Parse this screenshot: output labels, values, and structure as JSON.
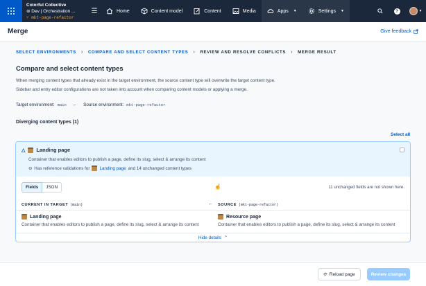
{
  "nav": {
    "org": "Colorful Collective",
    "environment": "Dev | Orchestration ...",
    "branch": "mkt-page-refactor",
    "items": [
      {
        "label": "Home"
      },
      {
        "label": "Content model"
      },
      {
        "label": "Content"
      },
      {
        "label": "Media"
      },
      {
        "label": "Apps"
      },
      {
        "label": "Settings"
      }
    ]
  },
  "header": {
    "title": "Merge",
    "feedback": "Give feedback"
  },
  "steps": [
    {
      "label": "SELECT ENVIRONMENTS"
    },
    {
      "label": "COMPARE AND SELECT CONTENT TYPES"
    },
    {
      "label": "REVIEW AND RESOLVE CONFLICTS"
    },
    {
      "label": "MERGE RESULT"
    }
  ],
  "main": {
    "heading": "Compare and select content types",
    "desc1": "When merging content types that already exist in the target environment, the source content type will overwrite the target content type.",
    "desc2": "Sidebar and entry editor configurations are not taken into account when comparing content models or applying a merge.",
    "target_label": "Target environment:",
    "target_value": "main",
    "source_label": "Source environment:",
    "source_value": "mkt-page-refactor",
    "diverging": "Diverging content types (1)",
    "select_all": "Select all"
  },
  "card": {
    "name": "Landing page",
    "description": "Container that enables editors to publish a page, define its slug, select & arrange its content",
    "ref_prefix": "Has reference validations for",
    "ref_link": "Landing page",
    "ref_suffix": "and 14 unchanged content types",
    "tab_fields": "Fields",
    "tab_json": "JSON",
    "unchanged_note": "11 unchanged fields are not shown here.",
    "target_col": "CURRENT IN TARGET",
    "target_env": "(main)",
    "source_col": "SOURCE",
    "source_env": "(mkt-page-refactor)",
    "target_name": "Landing page",
    "target_desc": "Container that enables editors to publish a page, define its slug, select & arrange its content",
    "source_name": "Resource page",
    "source_desc": "Container that enables editors to publish a page, define its slug, select & arrange its content",
    "hide_details": "Hide details"
  },
  "footer": {
    "reload": "Reload page",
    "review": "Review changes"
  }
}
